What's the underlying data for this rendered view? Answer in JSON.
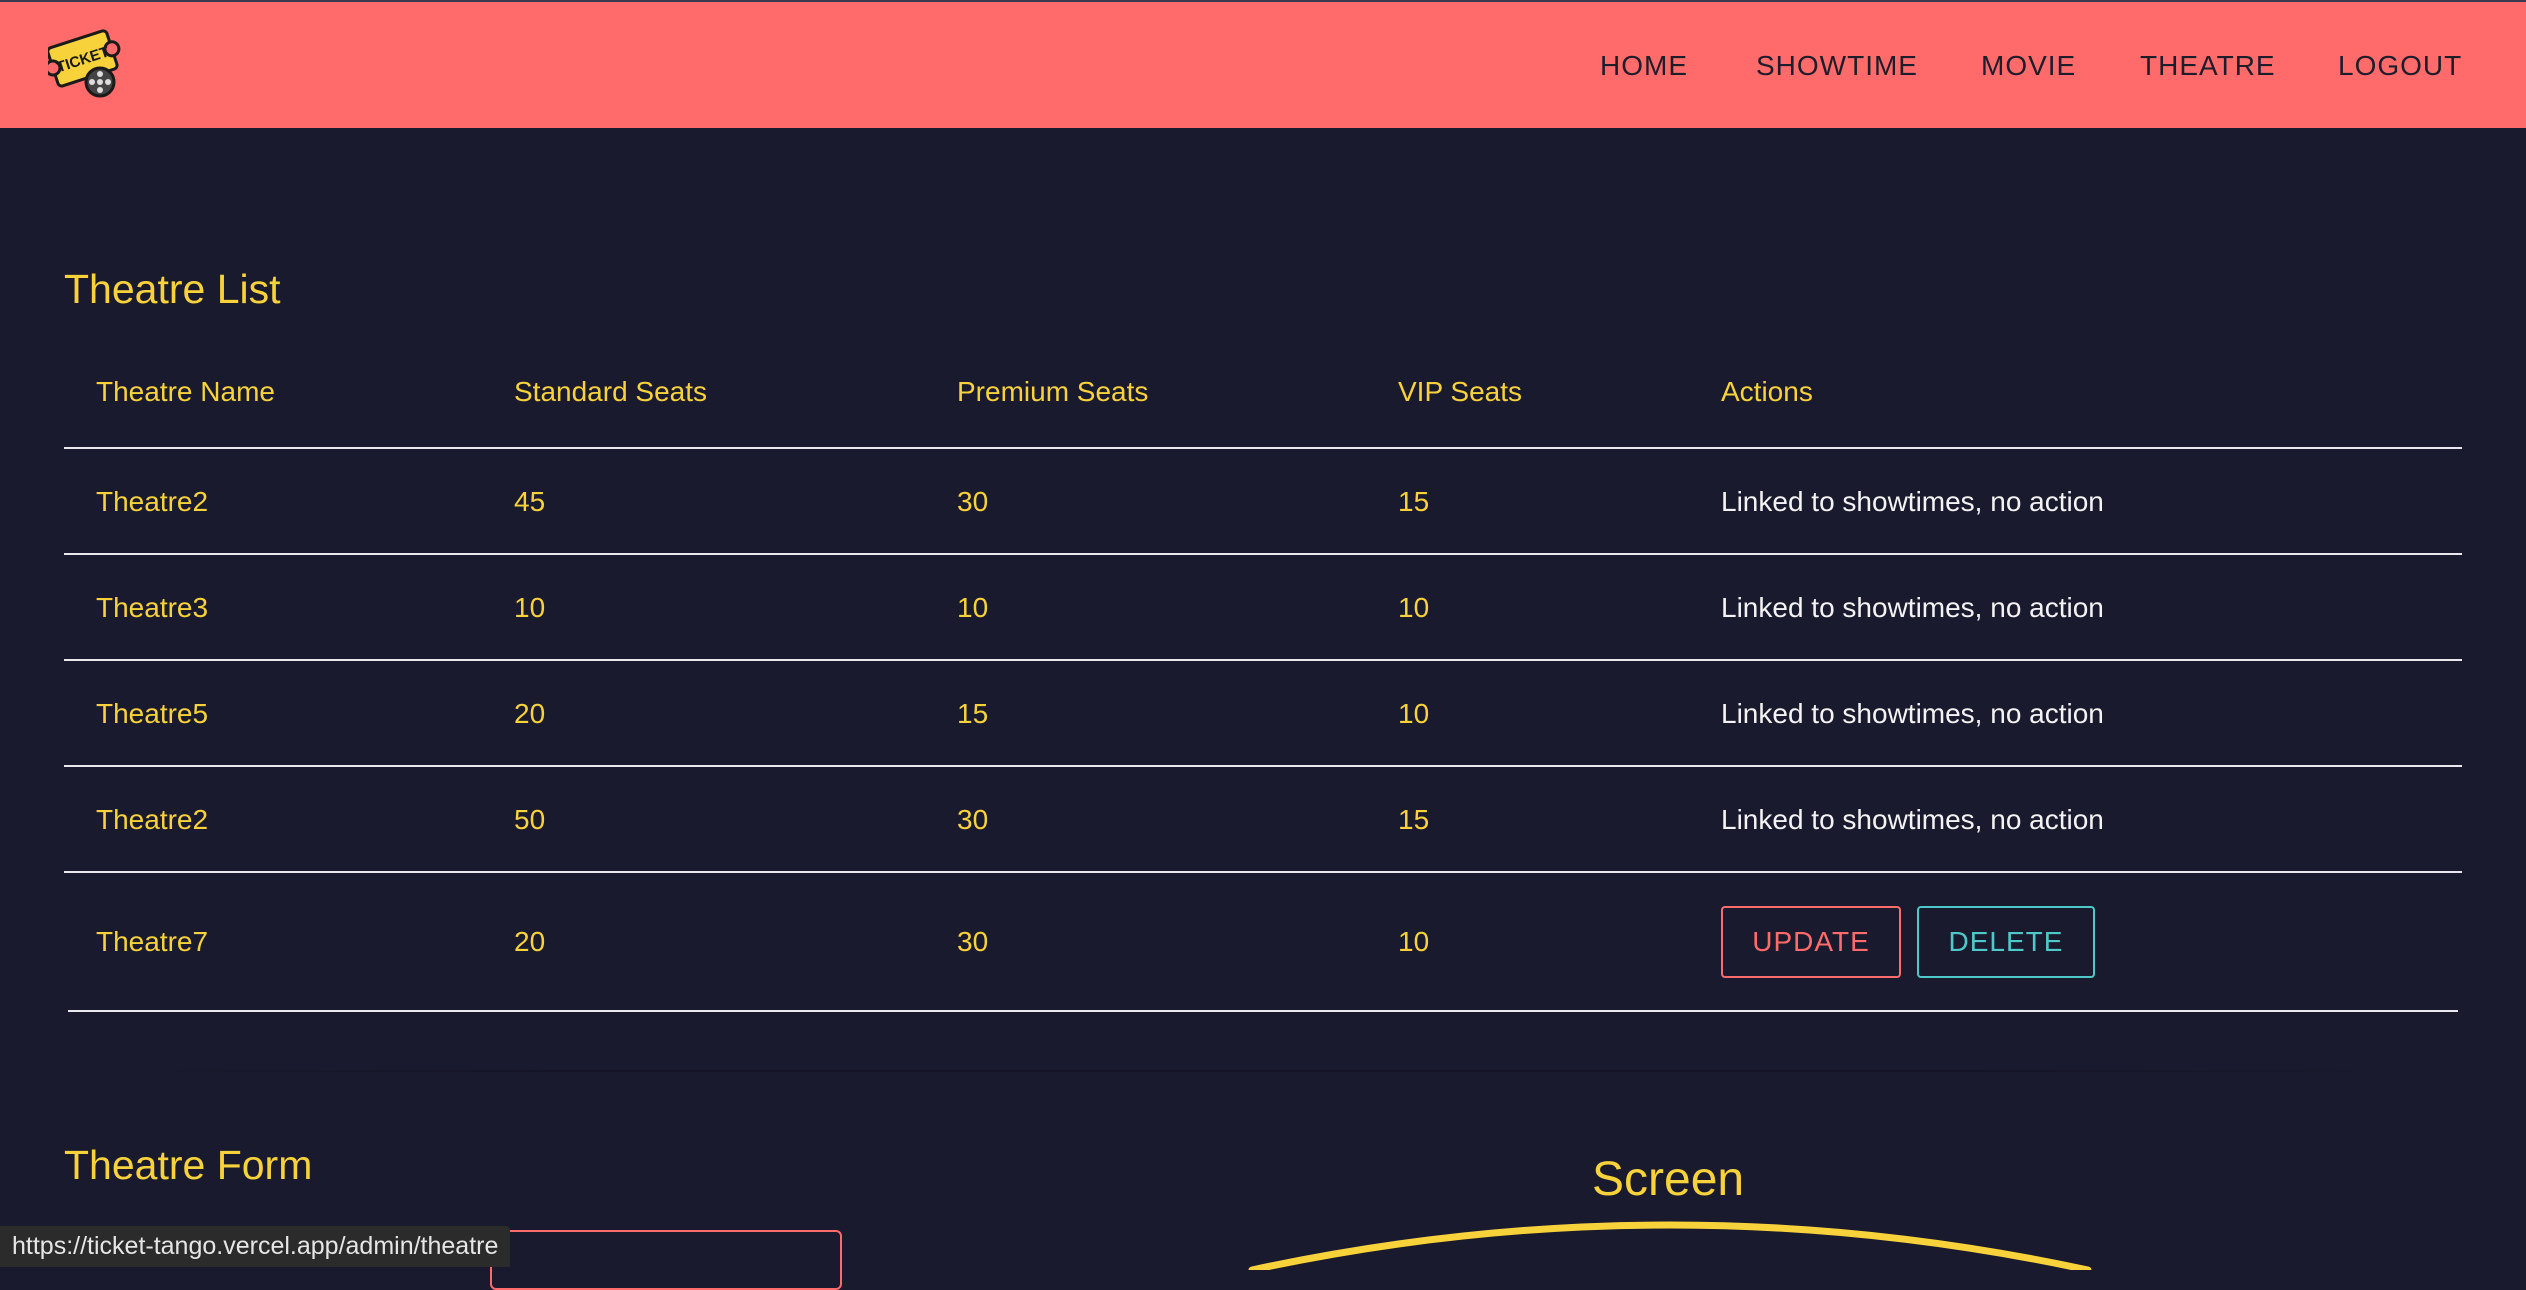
{
  "nav": {
    "logo_text": "TICKET",
    "items": [
      {
        "label": "HOME"
      },
      {
        "label": "SHOWTIME"
      },
      {
        "label": "MOVIE"
      },
      {
        "label": "THEATRE"
      },
      {
        "label": "LOGOUT"
      }
    ]
  },
  "theatre_list": {
    "title": "Theatre List",
    "columns": [
      "Theatre Name",
      "Standard Seats",
      "Premium Seats",
      "VIP Seats",
      "Actions"
    ],
    "rows": [
      {
        "name": "Theatre2",
        "standard": "45",
        "premium": "30",
        "vip": "15",
        "action_text": "Linked to showtimes, no action"
      },
      {
        "name": "Theatre3",
        "standard": "10",
        "premium": "10",
        "vip": "10",
        "action_text": "Linked to showtimes, no action"
      },
      {
        "name": "Theatre5",
        "standard": "20",
        "premium": "15",
        "vip": "10",
        "action_text": "Linked to showtimes, no action"
      },
      {
        "name": "Theatre2",
        "standard": "50",
        "premium": "30",
        "vip": "15",
        "action_text": "Linked to showtimes, no action"
      },
      {
        "name": "Theatre7",
        "standard": "20",
        "premium": "30",
        "vip": "10",
        "update_label": "UPDATE",
        "delete_label": "DELETE"
      }
    ]
  },
  "theatre_form": {
    "title": "Theatre Form",
    "screen_label": "Screen"
  },
  "status_bar": {
    "url": "https://ticket-tango.vercel.app/admin/theatre"
  },
  "colors": {
    "header": "#ff6b6b",
    "background": "#1a1a2e",
    "accent_yellow": "#f8d23a",
    "update": "#ff6b6b",
    "delete": "#4ec9c9"
  }
}
